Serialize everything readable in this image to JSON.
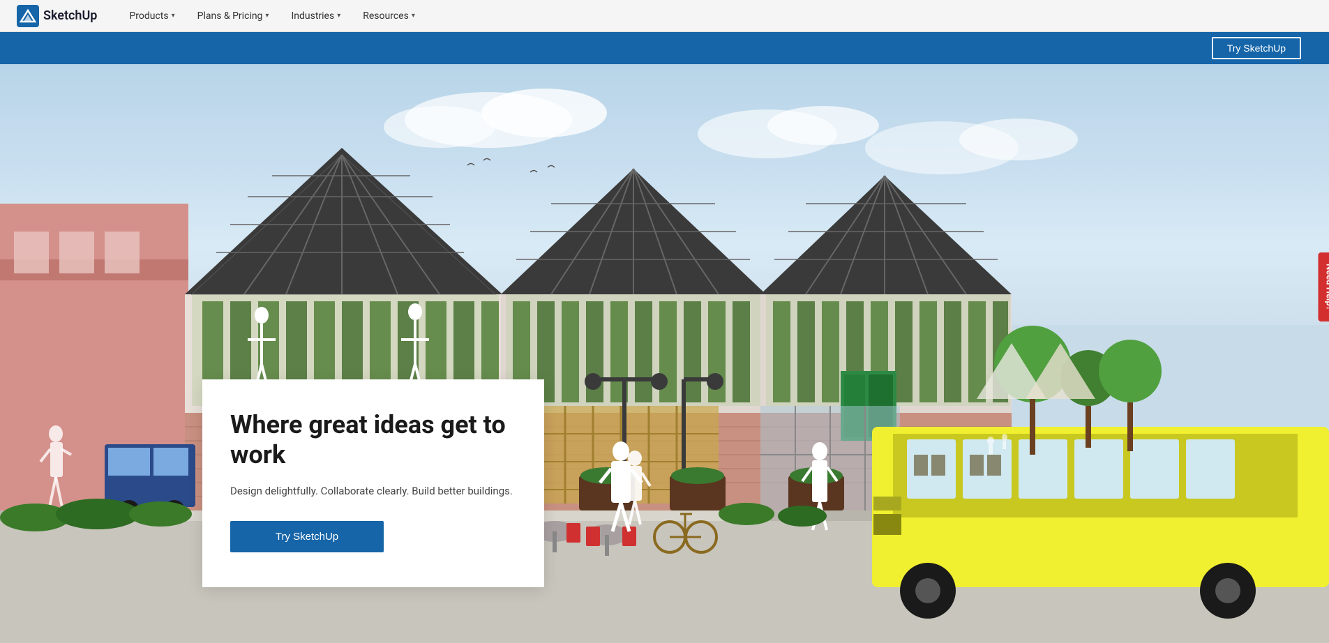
{
  "navbar": {
    "logo_text": "SketchUp",
    "nav_items": [
      {
        "label": "Products",
        "has_dropdown": true
      },
      {
        "label": "Plans & Pricing",
        "has_dropdown": true
      },
      {
        "label": "Industries",
        "has_dropdown": true
      },
      {
        "label": "Resources",
        "has_dropdown": true
      }
    ],
    "try_button_banner": "Try SketchUp"
  },
  "hero": {
    "title": "Where great ideas get to work",
    "subtitle": "Design delightfully. Collaborate clearly. Build better buildings.",
    "cta_button": "Try SketchUp"
  },
  "need_help": {
    "label": "Need Help?"
  },
  "colors": {
    "primary_blue": "#1565a8",
    "red": "#d32f2f",
    "white": "#ffffff",
    "dark_text": "#1a1a1a"
  }
}
